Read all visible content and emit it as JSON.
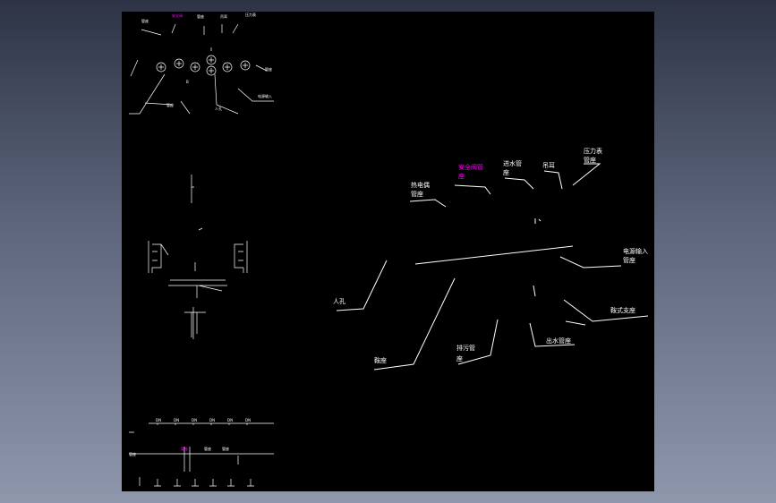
{
  "main_labels": {
    "heat_pipe": "热电偶管座",
    "safety_valve": "安全阀管座",
    "water_in": "进水管座",
    "lifting_ear": "吊耳",
    "pressure_gauge": "压力表管座",
    "power_input": "电源输入管座",
    "manhole": "人孔",
    "saddle_left": "鞍座",
    "drain": "排污管座",
    "water_out": "出水管座",
    "saddle_right": "鞍式支座"
  },
  "top_view_labels": {
    "a": "管座",
    "b": "安全阀",
    "c": "管座",
    "d": "吊耳",
    "e": "压力表",
    "f": "管座",
    "g": "管座",
    "h": "人孔",
    "i": "电源输入",
    "center_mark": "B"
  },
  "colors": {
    "sheet": "#000000",
    "line": "#ffffff",
    "highlight": "#ff00ff",
    "background_top": "#2e3446",
    "background_bottom": "#8e97ab"
  }
}
